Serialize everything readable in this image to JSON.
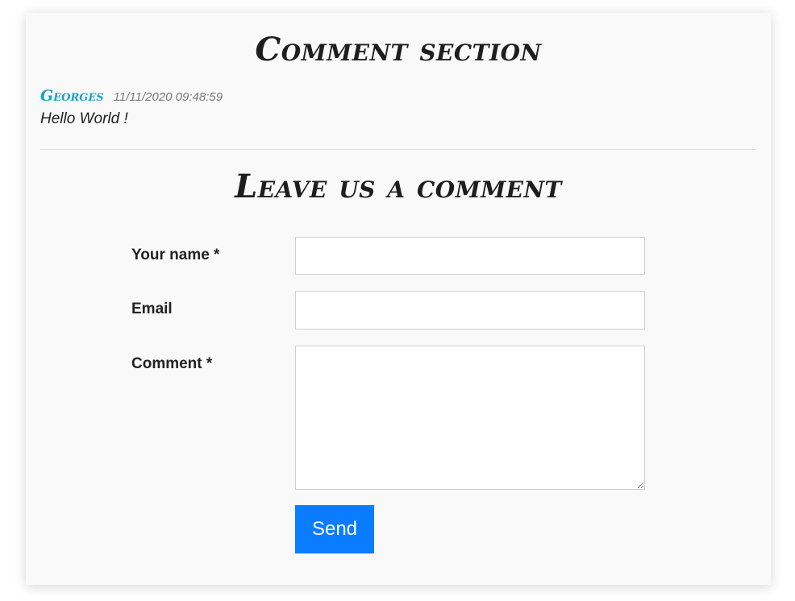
{
  "section_title": "Comment section",
  "comments": [
    {
      "author": "Georges",
      "date": "11/11/2020 09:48:59",
      "text": "Hello World !"
    }
  ],
  "form": {
    "title": "Leave us a comment",
    "name_label": "Your name *",
    "name_value": "",
    "email_label": "Email",
    "email_value": "",
    "comment_label": "Comment *",
    "comment_value": "",
    "submit_label": "Send"
  },
  "colors": {
    "accent": "#0a7cff",
    "author": "#17a2c6",
    "card_background": "#f9f9fa"
  }
}
